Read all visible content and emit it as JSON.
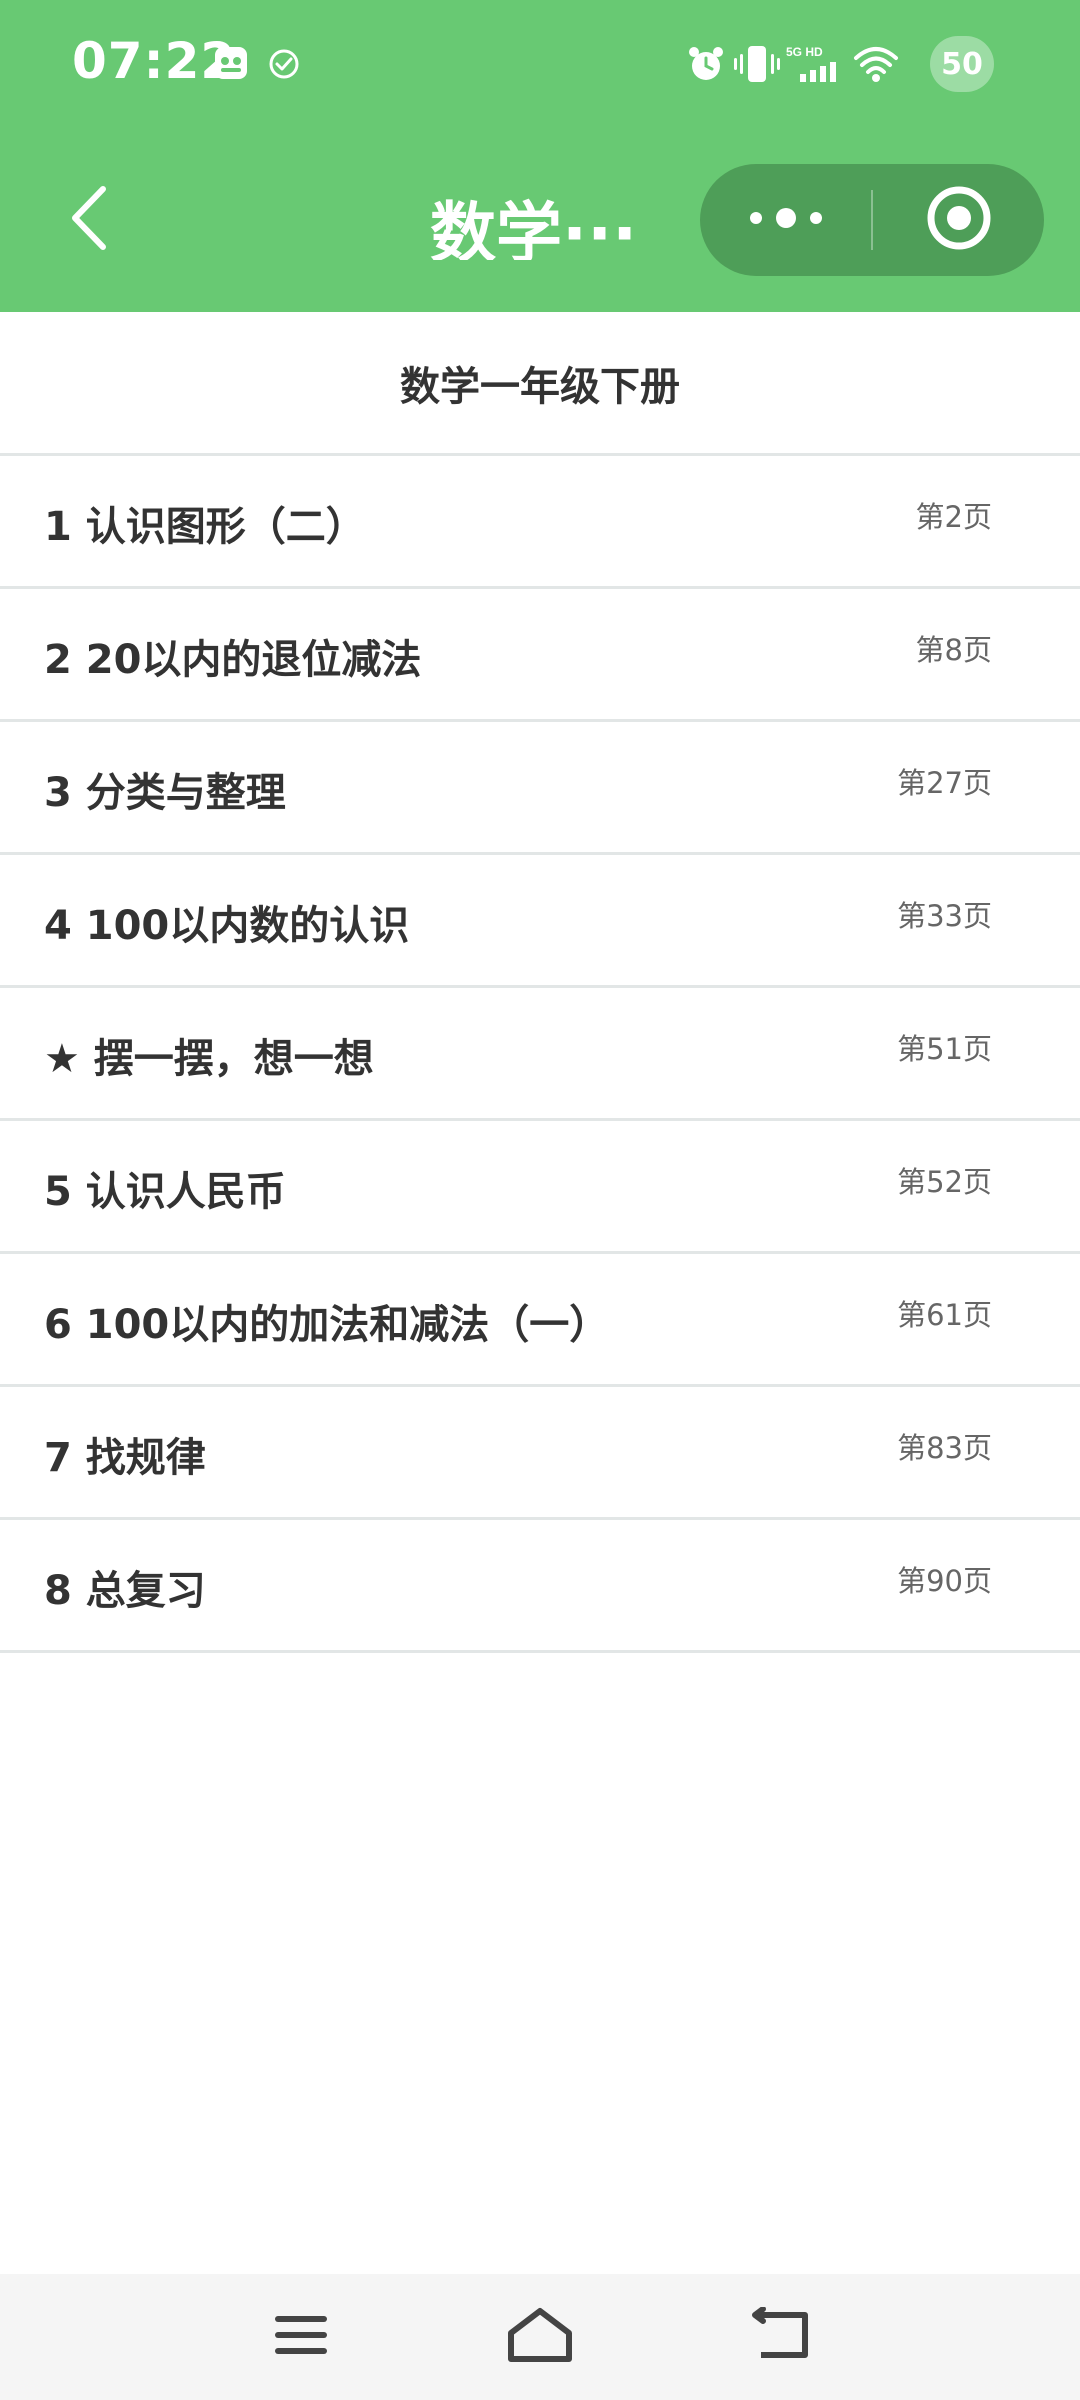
{
  "status_bar": {
    "time": "07:22",
    "battery": "50",
    "network": "5G HD",
    "icons": [
      "gallery-app-icon",
      "check-circle-icon",
      "alarm-icon",
      "vibrate-icon",
      "signal-icon",
      "wifi-icon"
    ]
  },
  "navbar": {
    "title": "数学···",
    "back_icon": "chevron-left-icon",
    "more_icon": "more-dots-icon",
    "close_icon": "target-close-icon"
  },
  "content": {
    "title": "数学一年级下册",
    "items": [
      {
        "label": "1 认识图形（二）",
        "page": "第2页"
      },
      {
        "label": "2 20以内的退位减法",
        "page": "第8页"
      },
      {
        "label": "3 分类与整理",
        "page": "第27页"
      },
      {
        "label": "4 100以内数的认识",
        "page": "第33页"
      },
      {
        "label": "★ 摆一摆，想一想",
        "page": "第51页"
      },
      {
        "label": "5 认识人民币",
        "page": "第52页"
      },
      {
        "label": "6 100以内的加法和减法（一）",
        "page": "第61页"
      },
      {
        "label": "7 找规律",
        "page": "第83页"
      },
      {
        "label": "8 总复习",
        "page": "第90页"
      }
    ]
  },
  "bottom_nav": {
    "icons": [
      "menu-icon",
      "home-icon",
      "back-icon"
    ]
  },
  "colors": {
    "brand": "#68C973",
    "capsule": "#4E9E58",
    "text": "#333333",
    "subtext": "#666666",
    "divider": "#E2E6E6"
  }
}
